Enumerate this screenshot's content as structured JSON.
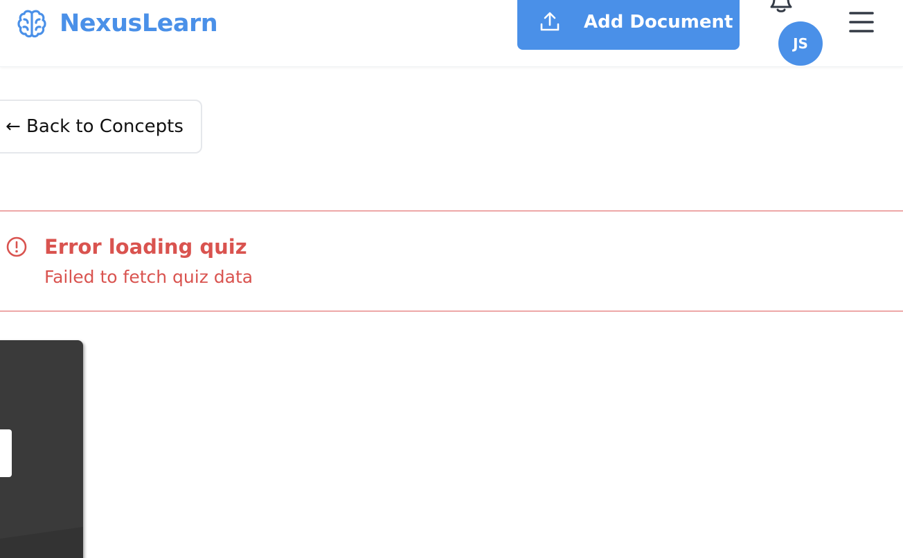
{
  "header": {
    "brand_name": "NexusLearn",
    "brand_icon": "brain-icon",
    "add_document_label": "Add Document",
    "upload_icon": "upload-icon",
    "bell_icon": "bell-icon",
    "avatar_initials": "JS",
    "menu_icon": "hamburger-menu-icon"
  },
  "navigation": {
    "back_label": "← Back to Concepts"
  },
  "alert": {
    "icon": "alert-circle-icon",
    "title": "Error loading quiz",
    "message": "Failed to fetch quiz data"
  },
  "colors": {
    "brand": "#4a90e8",
    "error": "#d9534f",
    "error_border": "#eda7a7",
    "panel": "#3a3a3a"
  }
}
